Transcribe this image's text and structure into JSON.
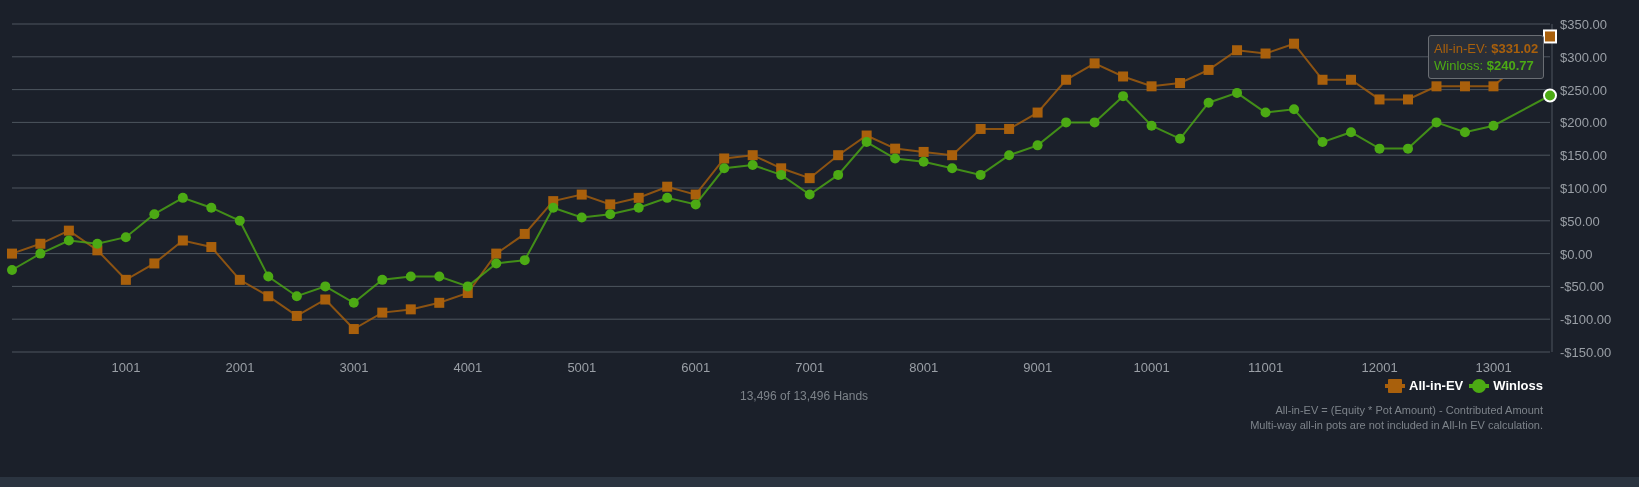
{
  "chart": {
    "chart_data": {
      "type": "line",
      "x": [
        1,
        250,
        500,
        750,
        1000,
        1250,
        1500,
        1750,
        2000,
        2250,
        2500,
        2750,
        3000,
        3250,
        3500,
        3750,
        4000,
        4250,
        4500,
        4750,
        5000,
        5250,
        5500,
        5750,
        6000,
        6250,
        6500,
        6750,
        7000,
        7250,
        7500,
        7750,
        8000,
        8250,
        8500,
        8750,
        9000,
        9250,
        9500,
        9750,
        10000,
        10250,
        10500,
        10750,
        11000,
        11250,
        11500,
        11750,
        12000,
        12250,
        12500,
        12750,
        13000,
        13496
      ],
      "series": [
        {
          "name": "All-in-EV",
          "color": "#a9600c",
          "marker": "square",
          "values": [
            0,
            15,
            35,
            5,
            -40,
            -15,
            20,
            10,
            -40,
            -65,
            -95,
            -70,
            -115,
            -90,
            -85,
            -75,
            -60,
            0,
            30,
            80,
            90,
            75,
            85,
            102,
            90,
            145,
            150,
            130,
            115,
            150,
            180,
            160,
            155,
            150,
            190,
            190,
            215,
            265,
            290,
            270,
            255,
            260,
            280,
            310,
            305,
            320,
            265,
            265,
            235,
            235,
            255,
            255,
            255,
            331
          ]
        },
        {
          "name": "Winloss",
          "color": "#4caa14",
          "marker": "circle",
          "values": [
            -25,
            0,
            20,
            15,
            25,
            60,
            85,
            70,
            50,
            -35,
            -65,
            -50,
            -75,
            -40,
            -35,
            -35,
            -50,
            -15,
            -10,
            70,
            55,
            60,
            70,
            85,
            75,
            130,
            135,
            120,
            90,
            120,
            170,
            145,
            140,
            130,
            120,
            150,
            165,
            200,
            200,
            240,
            195,
            175,
            230,
            245,
            215,
            220,
            170,
            185,
            160,
            160,
            200,
            185,
            195,
            241
          ]
        }
      ],
      "grid": true,
      "xlim": [
        1,
        13496
      ],
      "ylim": [
        -150,
        350
      ],
      "xticks": [
        1001,
        2001,
        3001,
        4001,
        5001,
        6001,
        7001,
        8001,
        9001,
        10001,
        11001,
        12001,
        13001
      ],
      "yticks": [
        {
          "value": 350,
          "label": "$350.00"
        },
        {
          "value": 300,
          "label": "$300.00"
        },
        {
          "value": 250,
          "label": "$250.00"
        },
        {
          "value": 200,
          "label": "$200.00"
        },
        {
          "value": 150,
          "label": "$150.00"
        },
        {
          "value": 100,
          "label": "$100.00"
        },
        {
          "value": 50,
          "label": "$50.00"
        },
        {
          "value": 0,
          "label": "$0.00"
        },
        {
          "value": -50,
          "label": "-$50.00"
        },
        {
          "value": -100,
          "label": "-$100.00"
        },
        {
          "value": -150,
          "label": "-$150.00"
        }
      ]
    },
    "tooltip": [
      "All-in-EV: **$331.02**",
      "Winloss: **$240.77**"
    ]
  },
  "hands_count": "13,496 of 13,496 Hands",
  "footnotes": [
    "All-in-EV = (Equity * Pot Amount) - Contributed Amount",
    "Multi-way all-in pots are not included in All-In EV calculation."
  ]
}
